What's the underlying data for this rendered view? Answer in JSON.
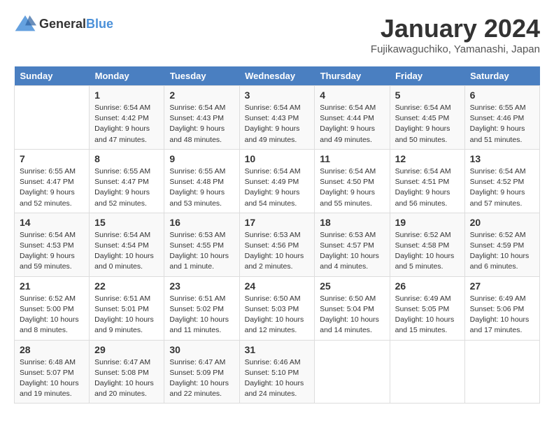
{
  "logo": {
    "text_general": "General",
    "text_blue": "Blue"
  },
  "title": "January 2024",
  "subtitle": "Fujikawaguchiko, Yamanashi, Japan",
  "days_of_week": [
    "Sunday",
    "Monday",
    "Tuesday",
    "Wednesday",
    "Thursday",
    "Friday",
    "Saturday"
  ],
  "weeks": [
    [
      {
        "day": "",
        "info": ""
      },
      {
        "day": "1",
        "info": "Sunrise: 6:54 AM\nSunset: 4:42 PM\nDaylight: 9 hours\nand 47 minutes."
      },
      {
        "day": "2",
        "info": "Sunrise: 6:54 AM\nSunset: 4:43 PM\nDaylight: 9 hours\nand 48 minutes."
      },
      {
        "day": "3",
        "info": "Sunrise: 6:54 AM\nSunset: 4:43 PM\nDaylight: 9 hours\nand 49 minutes."
      },
      {
        "day": "4",
        "info": "Sunrise: 6:54 AM\nSunset: 4:44 PM\nDaylight: 9 hours\nand 49 minutes."
      },
      {
        "day": "5",
        "info": "Sunrise: 6:54 AM\nSunset: 4:45 PM\nDaylight: 9 hours\nand 50 minutes."
      },
      {
        "day": "6",
        "info": "Sunrise: 6:55 AM\nSunset: 4:46 PM\nDaylight: 9 hours\nand 51 minutes."
      }
    ],
    [
      {
        "day": "7",
        "info": "Sunrise: 6:55 AM\nSunset: 4:47 PM\nDaylight: 9 hours\nand 52 minutes."
      },
      {
        "day": "8",
        "info": "Sunrise: 6:55 AM\nSunset: 4:47 PM\nDaylight: 9 hours\nand 52 minutes."
      },
      {
        "day": "9",
        "info": "Sunrise: 6:55 AM\nSunset: 4:48 PM\nDaylight: 9 hours\nand 53 minutes."
      },
      {
        "day": "10",
        "info": "Sunrise: 6:54 AM\nSunset: 4:49 PM\nDaylight: 9 hours\nand 54 minutes."
      },
      {
        "day": "11",
        "info": "Sunrise: 6:54 AM\nSunset: 4:50 PM\nDaylight: 9 hours\nand 55 minutes."
      },
      {
        "day": "12",
        "info": "Sunrise: 6:54 AM\nSunset: 4:51 PM\nDaylight: 9 hours\nand 56 minutes."
      },
      {
        "day": "13",
        "info": "Sunrise: 6:54 AM\nSunset: 4:52 PM\nDaylight: 9 hours\nand 57 minutes."
      }
    ],
    [
      {
        "day": "14",
        "info": "Sunrise: 6:54 AM\nSunset: 4:53 PM\nDaylight: 9 hours\nand 59 minutes."
      },
      {
        "day": "15",
        "info": "Sunrise: 6:54 AM\nSunset: 4:54 PM\nDaylight: 10 hours\nand 0 minutes."
      },
      {
        "day": "16",
        "info": "Sunrise: 6:53 AM\nSunset: 4:55 PM\nDaylight: 10 hours\nand 1 minute."
      },
      {
        "day": "17",
        "info": "Sunrise: 6:53 AM\nSunset: 4:56 PM\nDaylight: 10 hours\nand 2 minutes."
      },
      {
        "day": "18",
        "info": "Sunrise: 6:53 AM\nSunset: 4:57 PM\nDaylight: 10 hours\nand 4 minutes."
      },
      {
        "day": "19",
        "info": "Sunrise: 6:52 AM\nSunset: 4:58 PM\nDaylight: 10 hours\nand 5 minutes."
      },
      {
        "day": "20",
        "info": "Sunrise: 6:52 AM\nSunset: 4:59 PM\nDaylight: 10 hours\nand 6 minutes."
      }
    ],
    [
      {
        "day": "21",
        "info": "Sunrise: 6:52 AM\nSunset: 5:00 PM\nDaylight: 10 hours\nand 8 minutes."
      },
      {
        "day": "22",
        "info": "Sunrise: 6:51 AM\nSunset: 5:01 PM\nDaylight: 10 hours\nand 9 minutes."
      },
      {
        "day": "23",
        "info": "Sunrise: 6:51 AM\nSunset: 5:02 PM\nDaylight: 10 hours\nand 11 minutes."
      },
      {
        "day": "24",
        "info": "Sunrise: 6:50 AM\nSunset: 5:03 PM\nDaylight: 10 hours\nand 12 minutes."
      },
      {
        "day": "25",
        "info": "Sunrise: 6:50 AM\nSunset: 5:04 PM\nDaylight: 10 hours\nand 14 minutes."
      },
      {
        "day": "26",
        "info": "Sunrise: 6:49 AM\nSunset: 5:05 PM\nDaylight: 10 hours\nand 15 minutes."
      },
      {
        "day": "27",
        "info": "Sunrise: 6:49 AM\nSunset: 5:06 PM\nDaylight: 10 hours\nand 17 minutes."
      }
    ],
    [
      {
        "day": "28",
        "info": "Sunrise: 6:48 AM\nSunset: 5:07 PM\nDaylight: 10 hours\nand 19 minutes."
      },
      {
        "day": "29",
        "info": "Sunrise: 6:47 AM\nSunset: 5:08 PM\nDaylight: 10 hours\nand 20 minutes."
      },
      {
        "day": "30",
        "info": "Sunrise: 6:47 AM\nSunset: 5:09 PM\nDaylight: 10 hours\nand 22 minutes."
      },
      {
        "day": "31",
        "info": "Sunrise: 6:46 AM\nSunset: 5:10 PM\nDaylight: 10 hours\nand 24 minutes."
      },
      {
        "day": "",
        "info": ""
      },
      {
        "day": "",
        "info": ""
      },
      {
        "day": "",
        "info": ""
      }
    ]
  ]
}
